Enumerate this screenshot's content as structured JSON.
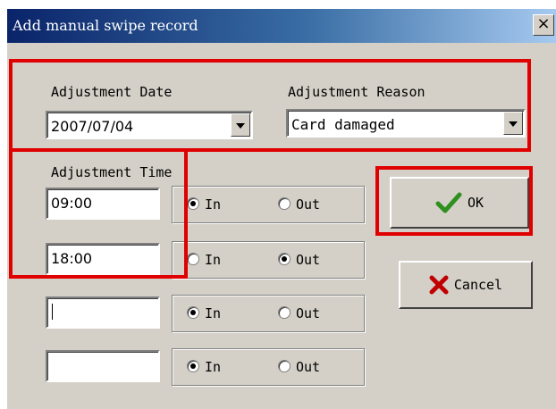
{
  "window": {
    "title": "Add manual swipe record",
    "close_label": "×"
  },
  "date": {
    "label": "Adjustment Date",
    "value": "2007/07/04"
  },
  "reason": {
    "label": "Adjustment Reason",
    "value": "Card damaged"
  },
  "time": {
    "label": "Adjustment Time",
    "rows": [
      {
        "value": "09:00",
        "in_label": "In",
        "out_label": "Out",
        "selected": "in"
      },
      {
        "value": "18:00",
        "in_label": "In",
        "out_label": "Out",
        "selected": "out"
      },
      {
        "value": "",
        "in_label": "In",
        "out_label": "Out",
        "selected": "in"
      },
      {
        "value": "",
        "in_label": "In",
        "out_label": "Out",
        "selected": "in"
      }
    ]
  },
  "buttons": {
    "ok_label": "OK",
    "cancel_label": "Cancel"
  },
  "colors": {
    "highlight": "#e00000",
    "ok_check": "#2f8f1f",
    "cancel_x": "#c00000"
  }
}
